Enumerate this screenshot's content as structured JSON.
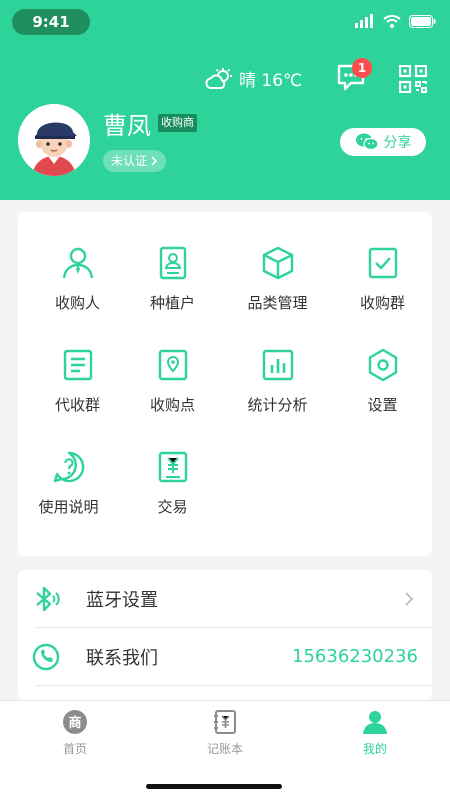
{
  "status_bar": {
    "time": "9:41"
  },
  "header": {
    "weather_text": "晴 16℃",
    "message_badge": "1",
    "user_name": "曹凤",
    "user_tag": "收购商",
    "verify_label": "未认证",
    "share_label": "分享"
  },
  "grid": {
    "items": [
      {
        "label": "收购人",
        "icon": "person-icon"
      },
      {
        "label": "种植户",
        "icon": "id-card-icon"
      },
      {
        "label": "品类管理",
        "icon": "box-icon"
      },
      {
        "label": "收购群",
        "icon": "check-square-icon"
      },
      {
        "label": "代收群",
        "icon": "document-icon"
      },
      {
        "label": "收购点",
        "icon": "location-pin-icon"
      },
      {
        "label": "统计分析",
        "icon": "bar-chart-icon"
      },
      {
        "label": "设置",
        "icon": "hexagon-gear-icon"
      },
      {
        "label": "使用说明",
        "icon": "help-bubble-icon"
      },
      {
        "label": "交易",
        "icon": "yen-receipt-icon"
      }
    ]
  },
  "list": {
    "bluetooth_label": "蓝牙设置",
    "contact_label": "联系我们",
    "contact_phone": "15636230236"
  },
  "tabbar": {
    "tabs": [
      {
        "label": "首页",
        "icon": "shop-icon"
      },
      {
        "label": "记账本",
        "icon": "ledger-icon"
      },
      {
        "label": "我的",
        "icon": "user-icon"
      }
    ]
  },
  "colors": {
    "brand": "#2ed39a",
    "badge": "#ff4d4f",
    "background": "#f3f4f6"
  }
}
